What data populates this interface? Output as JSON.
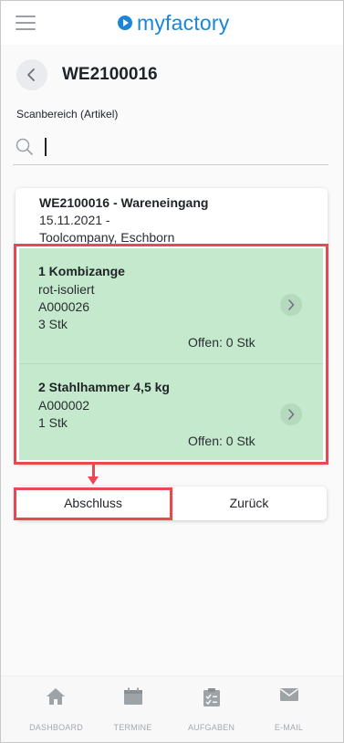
{
  "header": {
    "logo_text": "myfactory"
  },
  "page": {
    "title": "WE2100016",
    "scan_label": "Scanbereich (Artikel)",
    "search_value": ""
  },
  "card": {
    "title": "WE2100016 - Wareneingang",
    "date": "15.11.2021 -",
    "supplier": "Toolcompany, Eschborn"
  },
  "items": [
    {
      "name": "1 Kombizange",
      "lines": [
        "rot-isoliert",
        "A000026",
        "3 Stk"
      ],
      "open": "Offen: 0 Stk"
    },
    {
      "name": "2 Stahlhammer 4,5 kg",
      "lines": [
        "A000002",
        "1 Stk"
      ],
      "open": "Offen: 0 Stk"
    }
  ],
  "buttons": {
    "primary": "Abschluss",
    "secondary": "Zurück"
  },
  "bottom_nav": [
    {
      "label": "DASHBOARD",
      "icon": "home-icon"
    },
    {
      "label": "TERMINE",
      "icon": "calendar-icon"
    },
    {
      "label": "AUFGABEN",
      "icon": "clipboard-icon"
    },
    {
      "label": "E-MAIL",
      "icon": "mail-icon"
    }
  ],
  "colors": {
    "brand": "#1b86d8",
    "item_bg": "#c5e9cc",
    "highlight": "#e8484f"
  }
}
